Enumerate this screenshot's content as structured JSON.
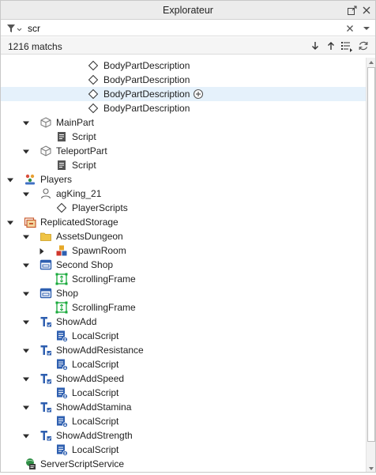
{
  "window": {
    "title": "Explorateur"
  },
  "search": {
    "value": "scr",
    "placeholder": ""
  },
  "matches": {
    "label": "1216 matchs"
  },
  "tree": [
    {
      "label": "BodyPartDescription",
      "depth": 5,
      "arrow": "none",
      "icon": "diamond",
      "selected": false
    },
    {
      "label": "BodyPartDescription",
      "depth": 5,
      "arrow": "none",
      "icon": "diamond",
      "selected": false
    },
    {
      "label": "BodyPartDescription",
      "depth": 5,
      "arrow": "none",
      "icon": "diamond",
      "selected": true,
      "add": true
    },
    {
      "label": "BodyPartDescription",
      "depth": 5,
      "arrow": "none",
      "icon": "diamond",
      "selected": false
    },
    {
      "label": "MainPart",
      "depth": 2,
      "arrow": "down",
      "icon": "part",
      "selected": false
    },
    {
      "label": "Script",
      "depth": 3,
      "arrow": "none",
      "icon": "script",
      "selected": false
    },
    {
      "label": "TeleportPart",
      "depth": 2,
      "arrow": "down",
      "icon": "part",
      "selected": false
    },
    {
      "label": "Script",
      "depth": 3,
      "arrow": "none",
      "icon": "script",
      "selected": false
    },
    {
      "label": "Players",
      "depth": 1,
      "arrow": "down",
      "icon": "players",
      "selected": false
    },
    {
      "label": "agKing_21",
      "depth": 2,
      "arrow": "down",
      "icon": "player",
      "selected": false
    },
    {
      "label": "PlayerScripts",
      "depth": 3,
      "arrow": "none",
      "icon": "diamond",
      "selected": false
    },
    {
      "label": "ReplicatedStorage",
      "depth": 1,
      "arrow": "down",
      "icon": "storage",
      "selected": false
    },
    {
      "label": "AssetsDungeon",
      "depth": 2,
      "arrow": "down",
      "icon": "folder",
      "selected": false
    },
    {
      "label": "SpawnRoom",
      "depth": 3,
      "arrow": "right",
      "icon": "model",
      "selected": false
    },
    {
      "label": "Second Shop",
      "depth": 2,
      "arrow": "down",
      "icon": "screengui",
      "selected": false
    },
    {
      "label": "ScrollingFrame",
      "depth": 3,
      "arrow": "none",
      "icon": "scrollframe",
      "selected": false
    },
    {
      "label": "Shop",
      "depth": 2,
      "arrow": "down",
      "icon": "screengui",
      "selected": false
    },
    {
      "label": "ScrollingFrame",
      "depth": 3,
      "arrow": "none",
      "icon": "scrollframe",
      "selected": false
    },
    {
      "label": "ShowAdd",
      "depth": 2,
      "arrow": "down",
      "icon": "textlabel",
      "selected": false
    },
    {
      "label": "LocalScript",
      "depth": 3,
      "arrow": "none",
      "icon": "localscript",
      "selected": false
    },
    {
      "label": "ShowAddResistance",
      "depth": 2,
      "arrow": "down",
      "icon": "textlabel",
      "selected": false
    },
    {
      "label": "LocalScript",
      "depth": 3,
      "arrow": "none",
      "icon": "localscript",
      "selected": false
    },
    {
      "label": "ShowAddSpeed",
      "depth": 2,
      "arrow": "down",
      "icon": "textlabel",
      "selected": false
    },
    {
      "label": "LocalScript",
      "depth": 3,
      "arrow": "none",
      "icon": "localscript",
      "selected": false
    },
    {
      "label": "ShowAddStamina",
      "depth": 2,
      "arrow": "down",
      "icon": "textlabel",
      "selected": false
    },
    {
      "label": "LocalScript",
      "depth": 3,
      "arrow": "none",
      "icon": "localscript",
      "selected": false
    },
    {
      "label": "ShowAddStrength",
      "depth": 2,
      "arrow": "down",
      "icon": "textlabel",
      "selected": false
    },
    {
      "label": "LocalScript",
      "depth": 3,
      "arrow": "none",
      "icon": "localscript",
      "selected": false
    },
    {
      "label": "ServerScriptService",
      "depth": 1,
      "arrow": "none",
      "icon": "serverscript",
      "selected": false
    }
  ],
  "colors": {
    "selected_row": "#e5f1fb",
    "script_blue": "#2e5fb0",
    "gui_green": "#17a93a",
    "folder_yellow": "#f0c445"
  }
}
